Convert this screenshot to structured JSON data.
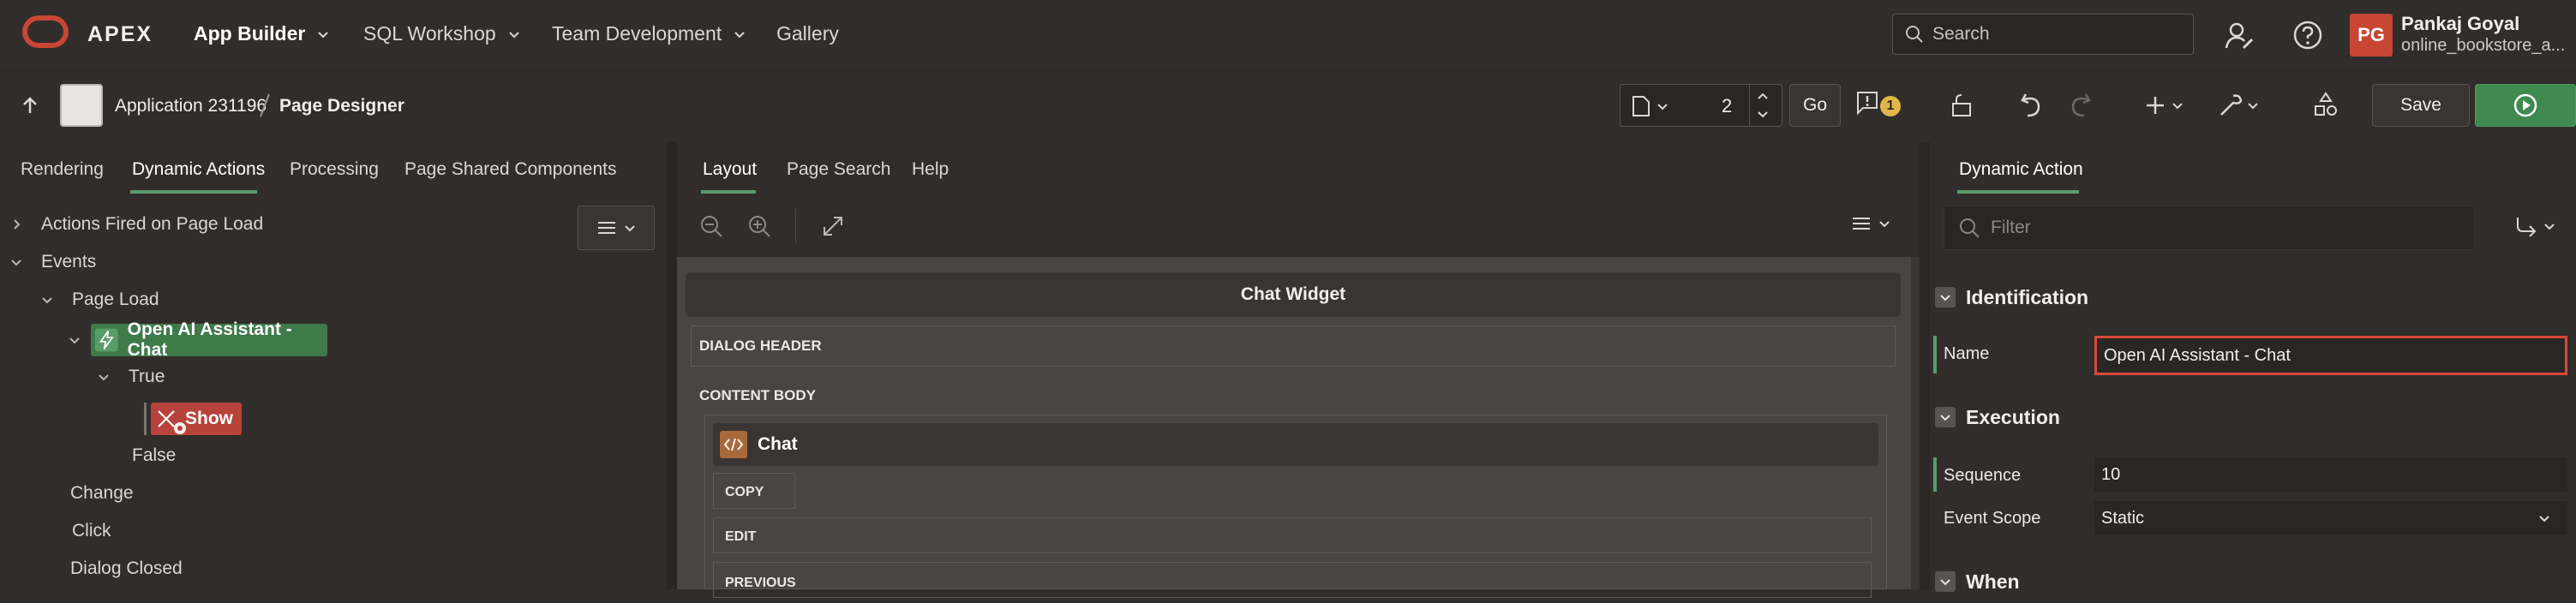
{
  "header": {
    "brand": "APEX",
    "nav": [
      {
        "label": "App Builder"
      },
      {
        "label": "SQL Workshop"
      },
      {
        "label": "Team Development"
      },
      {
        "label": "Gallery"
      }
    ],
    "search_placeholder": "Search",
    "user": {
      "initials": "PG",
      "name": "Pankaj Goyal",
      "workspace": "online_bookstore_a..."
    }
  },
  "toolbar": {
    "app_label": "Application 231196",
    "page_label": "Page Designer",
    "page_number": "2",
    "go_label": "Go",
    "warnings_count": "1",
    "save_label": "Save"
  },
  "left_pane": {
    "tabs": [
      "Rendering",
      "Dynamic Actions",
      "Processing",
      "Page Shared Components"
    ],
    "tree": {
      "actions_fired": "Actions Fired on Page Load",
      "events": "Events",
      "page_load": "Page Load",
      "dynamic_action": "Open AI Assistant - Chat",
      "true_branch": "True",
      "show_action": "Show",
      "false_branch": "False",
      "change": "Change",
      "click": "Click",
      "dialog_closed": "Dialog Closed"
    }
  },
  "middle_pane": {
    "tabs": [
      "Layout",
      "Page Search",
      "Help"
    ],
    "region_title": "Chat Widget",
    "dialog_header": "DIALOG HEADER",
    "content_body": "CONTENT BODY",
    "chat_region": "Chat",
    "slots": [
      "COPY",
      "EDIT",
      "PREVIOUS"
    ]
  },
  "right_pane": {
    "tab": "Dynamic Action",
    "filter_placeholder": "Filter",
    "groups": {
      "identification": "Identification",
      "execution": "Execution",
      "when": "When"
    },
    "props": {
      "name_label": "Name",
      "name_value": "Open AI Assistant - Chat",
      "sequence_label": "Sequence",
      "sequence_value": "10",
      "event_scope_label": "Event Scope",
      "event_scope_value": "Static"
    }
  },
  "colors": {
    "background": "#312d2a",
    "accent_red": "#c74634",
    "accent_green": "#3f8a4f",
    "error_border": "#d8483a"
  }
}
